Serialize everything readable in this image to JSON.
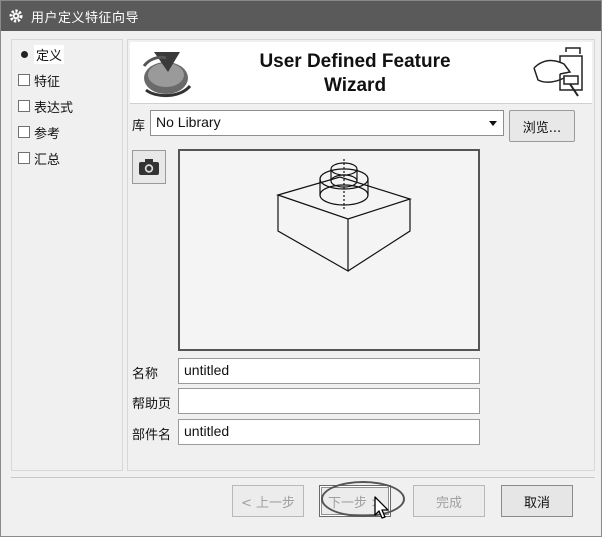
{
  "window": {
    "title": "用户定义特征向导",
    "title_icon": "gear-icon"
  },
  "steps": [
    {
      "label": "定义",
      "state": "current"
    },
    {
      "label": "特征",
      "state": "unchecked"
    },
    {
      "label": "表达式",
      "state": "unchecked"
    },
    {
      "label": "参考",
      "state": "unchecked"
    },
    {
      "label": "汇总",
      "state": "unchecked"
    }
  ],
  "header": {
    "title_line1": "User Defined Feature",
    "title_line2": "Wizard",
    "logo_icon": "feature-shape-icon",
    "hand_icon": "hand-pointer-icon"
  },
  "library": {
    "label": "库",
    "value": "No Library",
    "browse_label": "浏览..."
  },
  "preview": {
    "camera_icon": "camera-icon"
  },
  "fields": {
    "name_label": "名称",
    "name_value": "untitled",
    "help_label": "帮助页",
    "help_value": "",
    "part_label": "部件名",
    "part_value": "untitled"
  },
  "buttons": {
    "back": "< 上一步",
    "next": "下一步 >",
    "finish": "完成",
    "cancel": "取消"
  },
  "colors": {
    "titlebar": "#5a5a5a",
    "dialog_bg": "#f0f0f0"
  }
}
